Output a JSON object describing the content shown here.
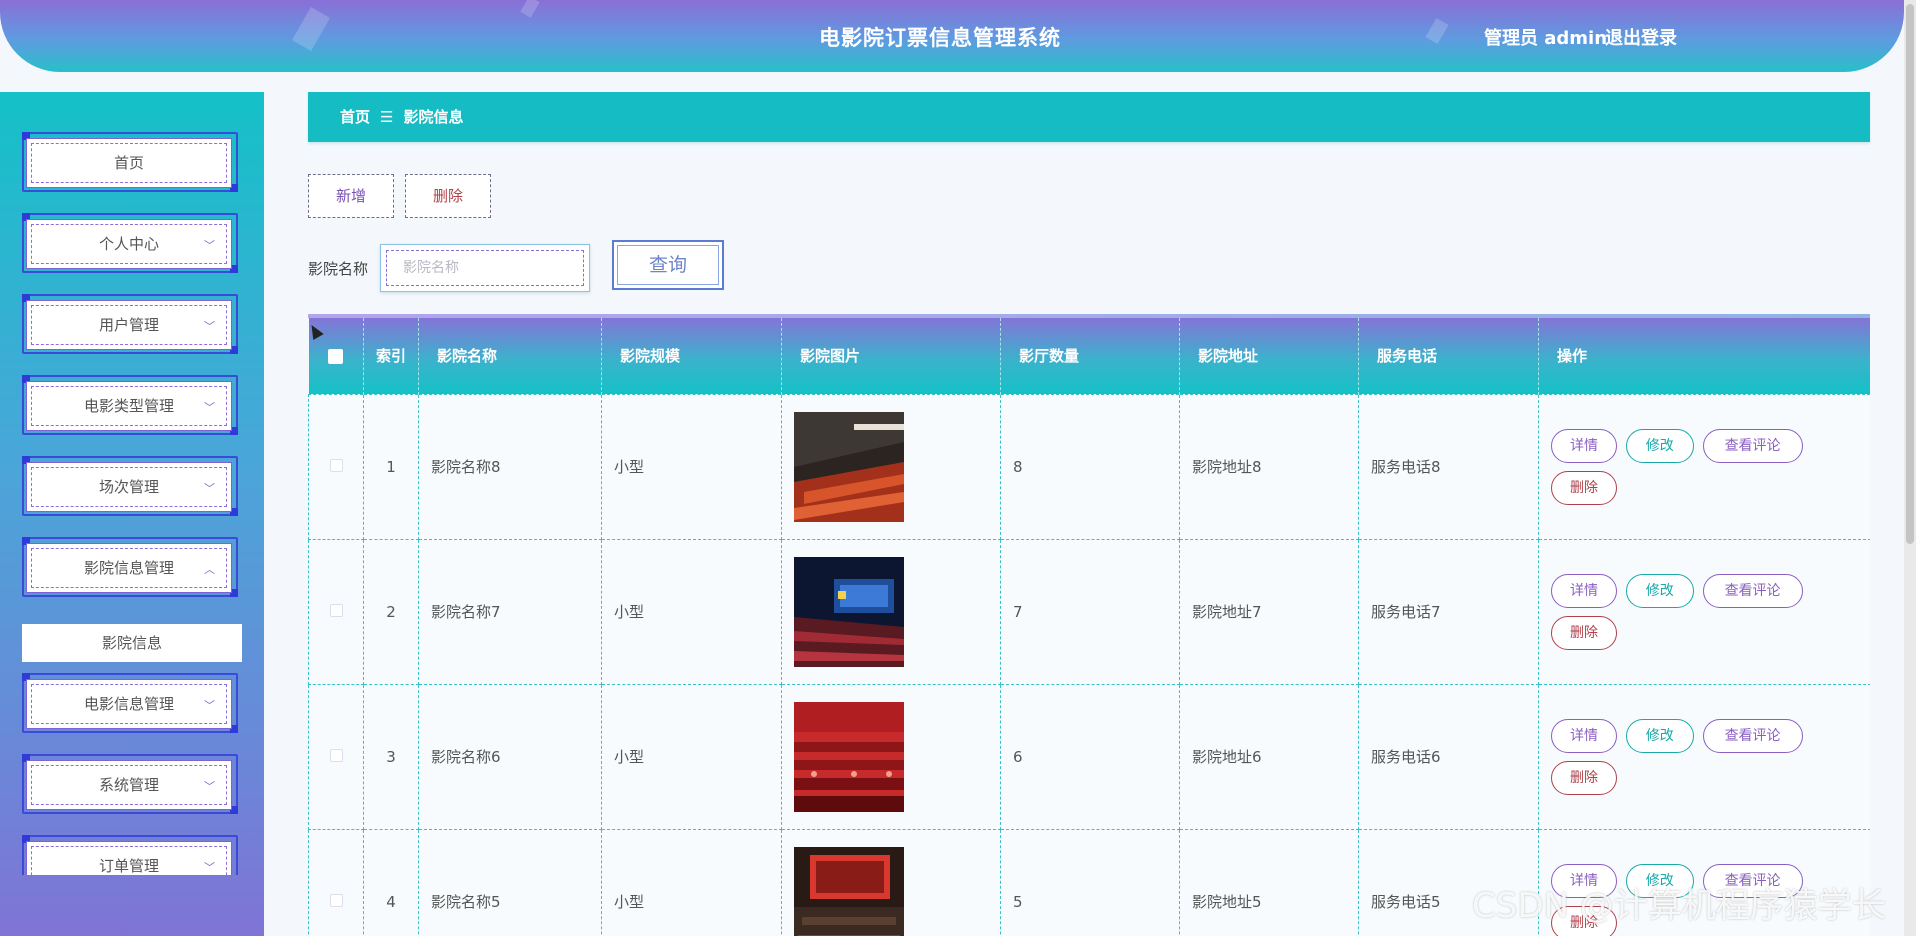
{
  "header": {
    "title": "电影院订票信息管理系统",
    "user": "管理员 admin",
    "logout": "退出登录"
  },
  "sidebar": {
    "items": [
      {
        "label": "首页",
        "chevron": ""
      },
      {
        "label": "个人中心",
        "chevron": "﹀"
      },
      {
        "label": "用户管理",
        "chevron": "﹀"
      },
      {
        "label": "电影类型管理",
        "chevron": "﹀"
      },
      {
        "label": "场次管理",
        "chevron": "﹀"
      },
      {
        "label": "影院信息管理",
        "chevron": "︿"
      },
      {
        "label": "电影信息管理",
        "chevron": "﹀"
      },
      {
        "label": "系统管理",
        "chevron": "﹀"
      },
      {
        "label": "订单管理",
        "chevron": "﹀"
      }
    ],
    "submenu_active": "影院信息"
  },
  "breadcrumb": {
    "home": "首页",
    "separator": "☰",
    "current": "影院信息"
  },
  "actions": {
    "add": "新增",
    "delete": "删除"
  },
  "search": {
    "label": "影院名称",
    "placeholder": "影院名称",
    "button": "查询"
  },
  "table": {
    "columns": [
      "",
      "索引",
      "影院名称",
      "影院规模",
      "影院图片",
      "影厅数量",
      "影院地址",
      "服务电话",
      "操作"
    ],
    "rows": [
      {
        "index": "1",
        "name": "影院名称8",
        "scale": "小型",
        "halls": "8",
        "address": "影院地址8",
        "phone": "服务电话8"
      },
      {
        "index": "2",
        "name": "影院名称7",
        "scale": "小型",
        "halls": "7",
        "address": "影院地址7",
        "phone": "服务电话7"
      },
      {
        "index": "3",
        "name": "影院名称6",
        "scale": "小型",
        "halls": "6",
        "address": "影院地址6",
        "phone": "服务电话6"
      },
      {
        "index": "4",
        "name": "影院名称5",
        "scale": "小型",
        "halls": "5",
        "address": "影院地址5",
        "phone": "服务电话5"
      }
    ],
    "row_actions": {
      "detail": "详情",
      "edit": "修改",
      "comments": "查看评论",
      "delete": "删除"
    }
  },
  "watermark": "CSDN @计算机程序猿学长",
  "colors": {
    "teal": "#15bcc4",
    "purple": "#8a6fd6",
    "detail_btn": "#8a5fc2",
    "edit_btn": "#19a9a9",
    "delete_btn": "#b0414a"
  }
}
